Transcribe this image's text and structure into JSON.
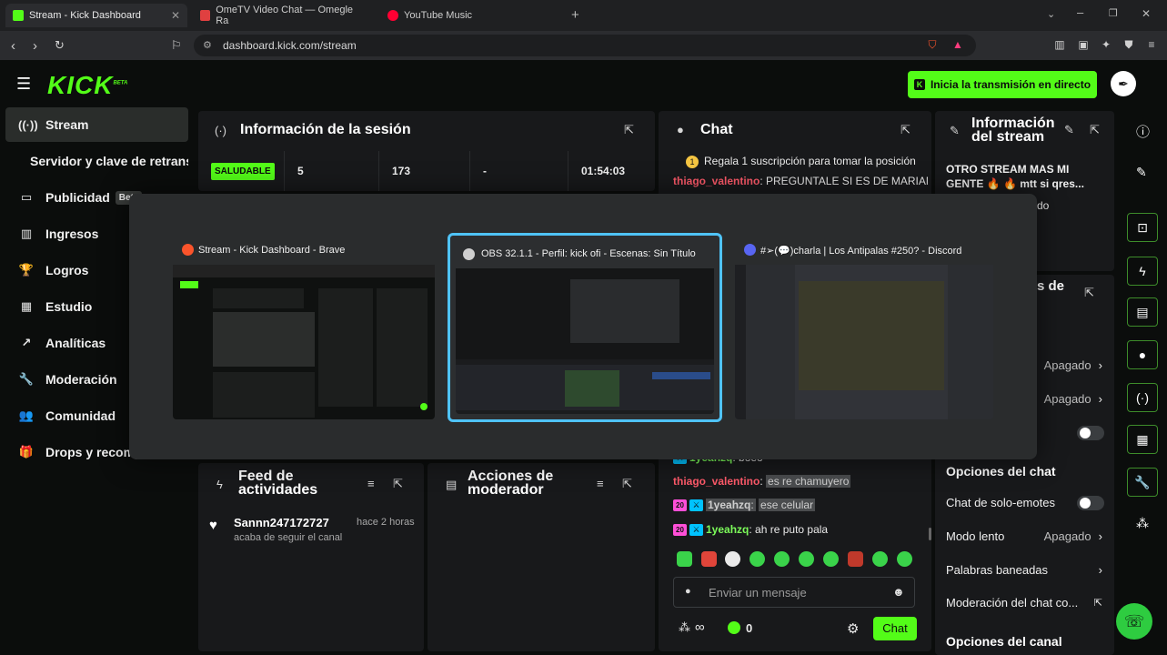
{
  "browser": {
    "tabs": [
      {
        "label": "Stream - Kick Dashboard",
        "active": true
      },
      {
        "label": "OmeTV Video Chat — Omegle Ra",
        "active": false
      },
      {
        "label": "YouTube Music",
        "active": false
      }
    ],
    "url": "dashboard.kick.com/stream"
  },
  "header": {
    "logo": "KICK",
    "logo_sup": "BETA",
    "golive_label": "Inicia la transmisión en directo"
  },
  "sidebar": {
    "items": [
      {
        "label": "Stream",
        "icon": "broadcast-icon"
      },
      {
        "label": "Servidor y clave de retransmisión",
        "icon": ""
      },
      {
        "label": "Publicidad",
        "icon": "monitor-icon",
        "badge": "Beta"
      },
      {
        "label": "Ingresos",
        "icon": "chart-icon"
      },
      {
        "label": "Logros",
        "icon": "trophy-icon"
      },
      {
        "label": "Estudio",
        "icon": "studio-icon"
      },
      {
        "label": "Analíticas",
        "icon": "analytics-icon"
      },
      {
        "label": "Moderación",
        "icon": "wrench-icon"
      },
      {
        "label": "Comunidad",
        "icon": "users-icon"
      },
      {
        "label": "Drops y recompensas",
        "icon": "gift-icon"
      }
    ]
  },
  "session": {
    "title": "Información de la sesión",
    "status": "SALUDABLE",
    "stats": [
      "5",
      "173",
      "-",
      "01:54:03"
    ]
  },
  "chat": {
    "title": "Chat",
    "pinned": "Regala 1 suscripción para tomar la posición",
    "top_lines": [
      {
        "user": "thiago_valentino",
        "text": "PREGUNTALE SI ES DE MARIANO"
      }
    ],
    "bottom_lines": [
      {
        "badge": "",
        "user": "1yeahzq",
        "text": "boeo",
        "highlight": false
      },
      {
        "badge": "",
        "user": "thiago_valentino",
        "text": "es re chamuyero",
        "highlight": true
      },
      {
        "badge": "20",
        "user": "1yeahzq",
        "text": "ese celular",
        "highlight": true
      },
      {
        "badge": "20",
        "user": "1yeahzq",
        "text": "ah re puto pala",
        "highlight": false
      }
    ],
    "input_placeholder": "Enviar un mensaje",
    "infinity": "∞",
    "count": "0",
    "send_label": "Chat"
  },
  "stream_info": {
    "title": "Información del stream",
    "stream_title": "OTRO STREAM MAS MI GENTE 🔥 🔥 mtt si qres...",
    "partial_text": "do",
    "section_partial": "s de",
    "rows": [
      {
        "label": "",
        "value": "Apagado"
      },
      {
        "label": "",
        "value": "Apagado"
      }
    ],
    "chat_options_title": "Opciones del chat",
    "chat_options": [
      {
        "label": "Chat de solo-emotes",
        "value": ""
      },
      {
        "label": "Modo lento",
        "value": "Apagado"
      },
      {
        "label": "Palabras baneadas",
        "value": ""
      },
      {
        "label": "Moderación del chat co...",
        "value": ""
      }
    ],
    "channel_options_title": "Opciones del canal"
  },
  "feed": {
    "title": "Feed de actividades",
    "items": [
      {
        "user": "Sannn247172727",
        "time": "hace 2 horas",
        "text": "acaba de seguir el canal"
      }
    ]
  },
  "modactions": {
    "title": "Acciones de moderador"
  },
  "switcher": {
    "windows": [
      {
        "title": "Stream - Kick Dashboard - Brave",
        "icon": "brave-icon"
      },
      {
        "title": "OBS 32.1.1 - Perfil: kick ofi - Escenas: Sin Título",
        "icon": "obs-icon"
      },
      {
        "title": "#➢(💬)charla | Los Antipalas #250? - Discord",
        "icon": "discord-icon"
      }
    ]
  },
  "colors": {
    "kick_green": "#53fc18",
    "panel_bg": "#18191b",
    "page_bg": "#0b0d0c",
    "username_red": "#ff5a6a",
    "username_green": "#7cfc5a",
    "selected_border": "#4fc3f7"
  }
}
